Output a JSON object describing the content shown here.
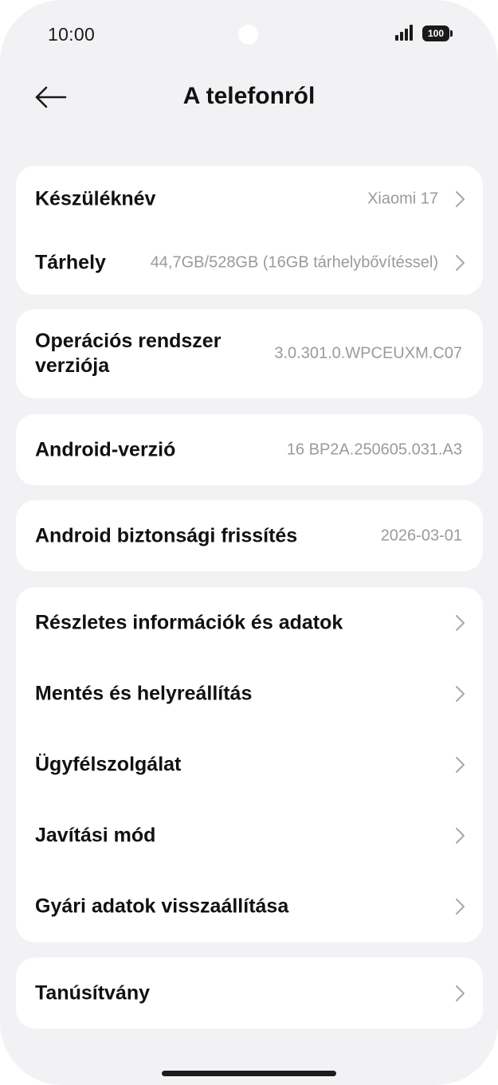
{
  "status_bar": {
    "time": "10:00",
    "battery": "100"
  },
  "header": {
    "title": "A telefonról"
  },
  "groups": [
    {
      "rows": [
        {
          "label": "Készüléknév",
          "value": "Xiaomi 17"
        },
        {
          "label": "Tárhely",
          "value": "44,7GB/528GB (16GB tárhelybővítéssel)"
        }
      ]
    },
    {
      "rows": [
        {
          "label": "Operációs rendszer verziója",
          "value": "3.0.301.0.WPCEUXM.C07"
        }
      ]
    },
    {
      "rows": [
        {
          "label": "Android-verzió",
          "value": "16 BP2A.250605.031.A3"
        }
      ]
    },
    {
      "rows": [
        {
          "label": "Android biztonsági frissítés",
          "value": "2026-03-01"
        }
      ]
    },
    {
      "rows": [
        {
          "label": "Részletes információk és adatok"
        },
        {
          "label": "Mentés és helyreállítás"
        },
        {
          "label": "Ügyfélszolgálat"
        },
        {
          "label": "Javítási mód"
        },
        {
          "label": "Gyári adatok visszaállítása"
        }
      ]
    },
    {
      "rows": [
        {
          "label": "Tanúsítvány"
        }
      ]
    }
  ],
  "icons": {
    "back": "arrow-left-icon",
    "chevron": "chevron-right-icon",
    "signal": "signal-icon",
    "battery": "battery-icon"
  },
  "colors": {
    "background": "#f2f2f4",
    "card": "#ffffff",
    "label": "#111111",
    "value": "#9a9a9a",
    "chevron": "#a8a8a8"
  }
}
